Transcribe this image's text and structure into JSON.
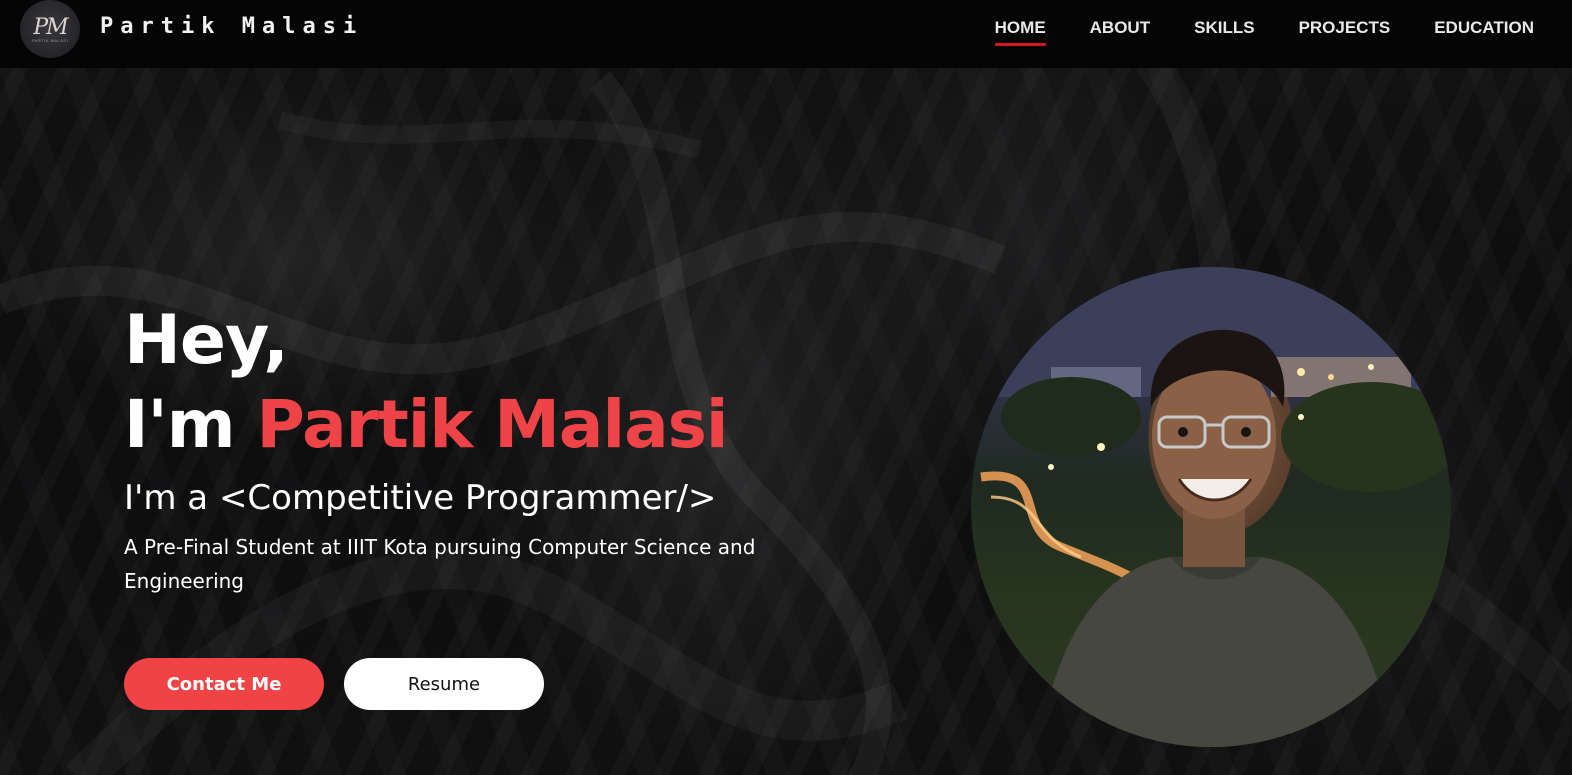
{
  "brand": {
    "logo_text": "PM",
    "logo_subtext": "PARTIK MALASI",
    "name": "Partik Malasi"
  },
  "nav": {
    "items": [
      {
        "label": "HOME",
        "active": true
      },
      {
        "label": "ABOUT",
        "active": false
      },
      {
        "label": "SKILLS",
        "active": false
      },
      {
        "label": "PROJECTS",
        "active": false
      },
      {
        "label": "EDUCATION",
        "active": false
      }
    ]
  },
  "hero": {
    "greeting": "Hey,",
    "intro_prefix": "I'm ",
    "intro_name": "Partik Malasi",
    "role": "I'm a <Competitive Programmer/>",
    "description": "A Pre-Final Student at IIIT Kota pursuing Computer Science and Engineering",
    "contact_label": "Contact Me",
    "resume_label": "Resume"
  },
  "colors": {
    "accent": "#ef4346",
    "nav_underline": "#d7151d",
    "header_bg": "#050505",
    "page_bg": "#111112"
  }
}
